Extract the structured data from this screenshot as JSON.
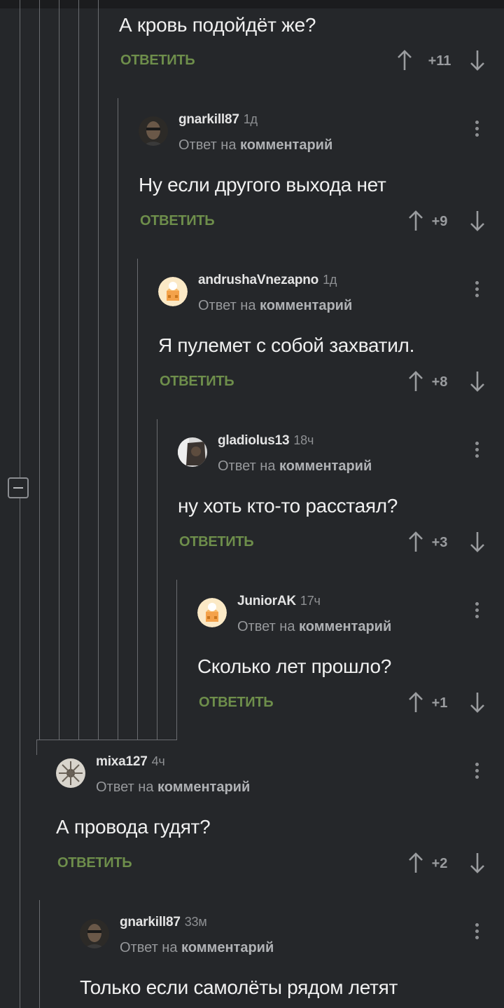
{
  "labels": {
    "reply": "ОТВЕТИТЬ",
    "reply_to_prefix": "Ответ на",
    "reply_to_link": "комментарий"
  },
  "top_comment": {
    "text": "А кровь подойдёт же?",
    "score": "+11"
  },
  "comments": [
    {
      "nick": "gnarkill87",
      "time": "1д",
      "text": "Ну если другого выхода нет",
      "score": "+9",
      "avatar": "photo-man-icon"
    },
    {
      "nick": "andrushaVnezapno",
      "time": "1д",
      "text": "Я пулемет с собой захватил.",
      "score": "+8",
      "avatar": "default-avatar-icon"
    },
    {
      "nick": "gladiolus13",
      "time": "18ч",
      "text": "ну хоть кто-то расстаял?",
      "score": "+3",
      "avatar": "photo-dark-icon"
    },
    {
      "nick": "JuniorAK",
      "time": "17ч",
      "text": "Сколько лет прошло?",
      "score": "+1",
      "avatar": "default-avatar-icon"
    },
    {
      "nick": "mixa127",
      "time": "4ч",
      "text": "А провода гудят?",
      "score": "+2",
      "avatar": "photo-sketch-icon"
    },
    {
      "nick": "gnarkill87",
      "time": "33м",
      "text": "Только если самолёты рядом летят",
      "score": "",
      "avatar": "photo-man-icon"
    }
  ],
  "colors": {
    "background": "#25272a",
    "reply": "#6e8e4b",
    "thread_line": "#6a6c70"
  }
}
